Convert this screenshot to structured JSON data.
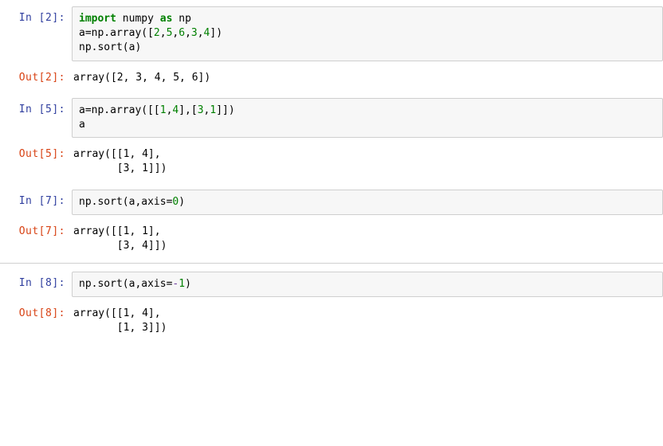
{
  "cells": [
    {
      "in_prompt": "In [2]:",
      "out_prompt": "Out[2]:",
      "code_tokens": [
        {
          "t": "import",
          "c": "kw-import"
        },
        {
          "t": " numpy ",
          "c": "name"
        },
        {
          "t": "as",
          "c": "kw-as"
        },
        {
          "t": " np\n",
          "c": "name"
        },
        {
          "t": "a=np.array(",
          "c": "name"
        },
        {
          "t": "[",
          "c": "paren"
        },
        {
          "t": "2",
          "c": "num"
        },
        {
          "t": ",",
          "c": "paren"
        },
        {
          "t": "5",
          "c": "num"
        },
        {
          "t": ",",
          "c": "paren"
        },
        {
          "t": "6",
          "c": "num"
        },
        {
          "t": ",",
          "c": "paren"
        },
        {
          "t": "3",
          "c": "num"
        },
        {
          "t": ",",
          "c": "paren"
        },
        {
          "t": "4",
          "c": "num"
        },
        {
          "t": "]",
          "c": "paren"
        },
        {
          "t": ")\n",
          "c": "name"
        },
        {
          "t": "np.sort(a)",
          "c": "name"
        }
      ],
      "output": "array([2, 3, 4, 5, 6])"
    },
    {
      "in_prompt": "In [5]:",
      "out_prompt": "Out[5]:",
      "code_tokens": [
        {
          "t": "a=np.array(",
          "c": "name"
        },
        {
          "t": "[[",
          "c": "paren"
        },
        {
          "t": "1",
          "c": "num"
        },
        {
          "t": ",",
          "c": "paren"
        },
        {
          "t": "4",
          "c": "num"
        },
        {
          "t": "],[",
          "c": "paren"
        },
        {
          "t": "3",
          "c": "num"
        },
        {
          "t": ",",
          "c": "paren"
        },
        {
          "t": "1",
          "c": "num"
        },
        {
          "t": "]]",
          "c": "paren"
        },
        {
          "t": ")\n",
          "c": "name"
        },
        {
          "t": "a",
          "c": "name"
        }
      ],
      "output": "array([[1, 4],\n       [3, 1]])"
    },
    {
      "in_prompt": "In [7]:",
      "out_prompt": "Out[7]:",
      "code_tokens": [
        {
          "t": "np.sort(a,axis=",
          "c": "name"
        },
        {
          "t": "0",
          "c": "num"
        },
        {
          "t": ")",
          "c": "name"
        }
      ],
      "output": "array([[1, 1],\n       [3, 4]])"
    },
    {
      "in_prompt": "In [8]:",
      "out_prompt": "Out[8]:",
      "code_tokens": [
        {
          "t": "np.sort(a,axis=",
          "c": "name"
        },
        {
          "t": "-",
          "c": "neg"
        },
        {
          "t": "1",
          "c": "num"
        },
        {
          "t": ")",
          "c": "name"
        }
      ],
      "output": "array([[1, 4],\n       [1, 3]])"
    }
  ]
}
